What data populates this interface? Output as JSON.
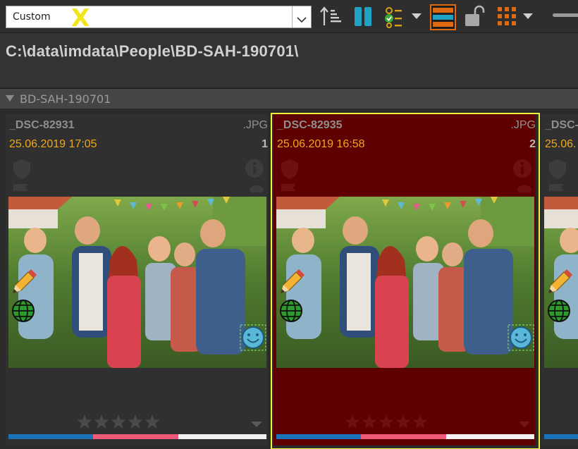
{
  "toolbar": {
    "preset_value": "Custom",
    "annotation_mark": "X",
    "icons": [
      "sort-ascending-icon",
      "pause-icon",
      "checklist-icon",
      "dropdown-icon",
      "view-mode-icon",
      "unlock-icon",
      "grid-layout-icon",
      "dropdown-icon",
      "zoom-slider"
    ]
  },
  "path": {
    "text": "C:\\data\\imdata\\People\\BD-SAH-190701\\"
  },
  "group": {
    "name": "BD-SAH-190701"
  },
  "thumbnails": [
    {
      "name": "_DSC-82931",
      "ext": ".JPG",
      "date": "25.06.2019 17:05",
      "index": "1",
      "rating": 0,
      "selected": false
    },
    {
      "name": "_DSC-82935",
      "ext": ".JPG",
      "date": "25.06.2019 16:58",
      "index": "2",
      "rating": 0,
      "selected": true
    },
    {
      "name": "_DSC-",
      "ext": "",
      "date": "25.06.",
      "index": "",
      "rating": 0,
      "selected": false
    }
  ],
  "colors": {
    "accent_teal": "#1fa2c3",
    "accent_orange": "#e06a12",
    "date_orange": "#f0a818",
    "selection_border": "#f2f23a",
    "selected_bg": "#5e0000",
    "label_blue": "#1a73b8",
    "label_pink": "#ee5a78",
    "label_white": "#f2f2f2"
  }
}
